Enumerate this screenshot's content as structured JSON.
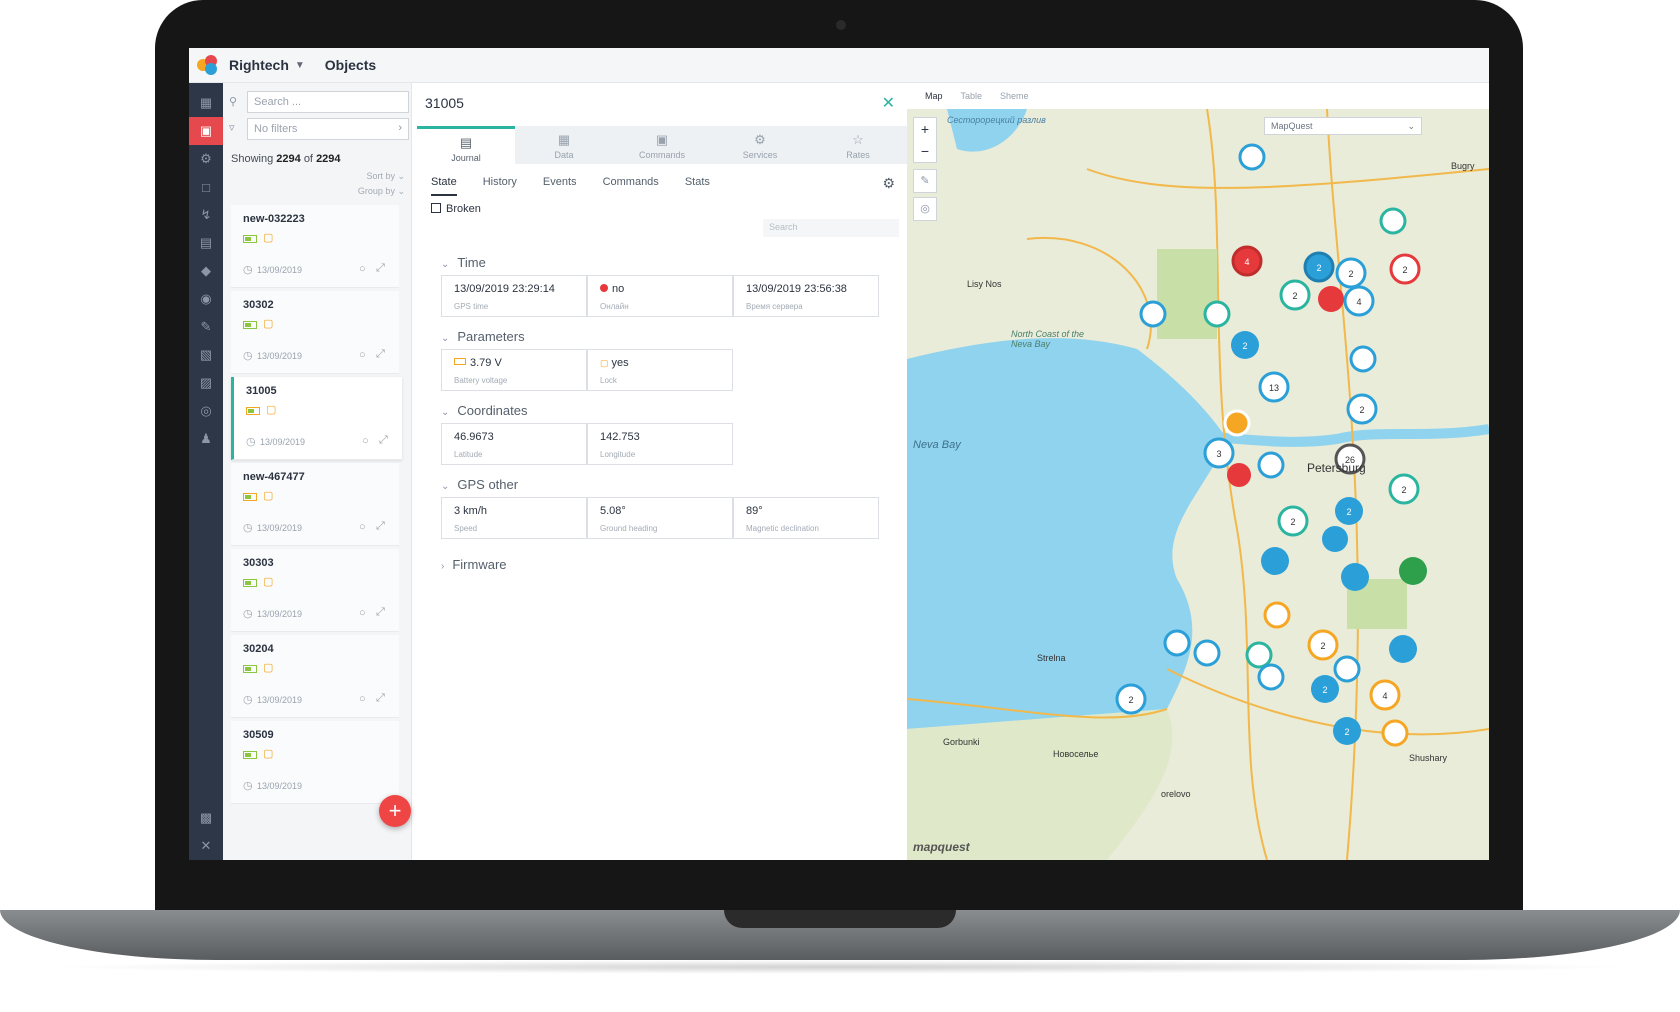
{
  "app": {
    "name": "Rightech",
    "section": "Objects"
  },
  "list": {
    "search_placeholder": "Search ...",
    "filter_placeholder": "No filters",
    "showing_prefix": "Showing",
    "showing_count": "2294",
    "showing_of": "of",
    "showing_total": "2294",
    "sort_by": "Sort by",
    "group_by": "Group by",
    "items": [
      {
        "name": "new-032223",
        "date": "13/09/2019"
      },
      {
        "name": "30302",
        "date": "13/09/2019"
      },
      {
        "name": "31005",
        "date": "13/09/2019"
      },
      {
        "name": "new-467477",
        "date": "13/09/2019"
      },
      {
        "name": "30303",
        "date": "13/09/2019"
      },
      {
        "name": "30204",
        "date": "13/09/2019"
      },
      {
        "name": "30509",
        "date": "13/09/2019"
      }
    ],
    "fab": "+"
  },
  "detail": {
    "title": "31005",
    "top_tabs": [
      "Journal",
      "Data",
      "Commands",
      "Services",
      "Rates"
    ],
    "sub_tabs": [
      "State",
      "History",
      "Events",
      "Commands",
      "Stats"
    ],
    "broken_label": "Broken",
    "search_placeholder": "Search",
    "sections": {
      "time": {
        "title": "Time",
        "gps_time": {
          "value": "13/09/2019 23:29:14",
          "label": "GPS time"
        },
        "online": {
          "value": "no",
          "label": "Онлайн"
        },
        "server_time": {
          "value": "13/09/2019 23:56:38",
          "label": "Время сервера"
        }
      },
      "parameters": {
        "title": "Parameters",
        "battery": {
          "value": "3.79 V",
          "label": "Battery voltage"
        },
        "lock": {
          "value": "yes",
          "label": "Lock"
        }
      },
      "coordinates": {
        "title": "Coordinates",
        "latitude": {
          "value": "46.9673",
          "label": "Latitude"
        },
        "longitude": {
          "value": "142.753",
          "label": "Longitude"
        }
      },
      "gps_other": {
        "title": "GPS other",
        "speed": {
          "value": "3 km/h",
          "label": "Speed"
        },
        "heading": {
          "value": "5.08°",
          "label": "Ground heading"
        },
        "declination": {
          "value": "89°",
          "label": "Magnetic declination"
        }
      },
      "firmware": {
        "title": "Firmware"
      }
    }
  },
  "map": {
    "tabs": [
      "Map",
      "Table",
      "Sheme"
    ],
    "layer": "MapQuest",
    "attribution": "mapquest",
    "labels": {
      "neva_bay": "Neva Bay",
      "lisy_nos": "Lisy Nos",
      "north_coast": "North Coast of the Neva Bay",
      "sestroretsk": "Сесторорецкий разлив",
      "petersburg": "Petersburg",
      "strelna": "Strelna",
      "gorbunki": "Gorbunki",
      "novoselye": "Новоселье",
      "shushary": "Shushary",
      "orelovo": "orelovo",
      "bugry": "Bugry"
    },
    "clusters": [
      "4",
      "2",
      "2",
      "2",
      "2",
      "4",
      "2",
      "13",
      "2",
      "3",
      "26",
      "2",
      "2",
      "2",
      "2",
      "2",
      "4",
      "2",
      "2"
    ]
  },
  "colors": {
    "accent": "#2bb5a0",
    "danger": "#e5393b",
    "rail": "#2d3748"
  }
}
